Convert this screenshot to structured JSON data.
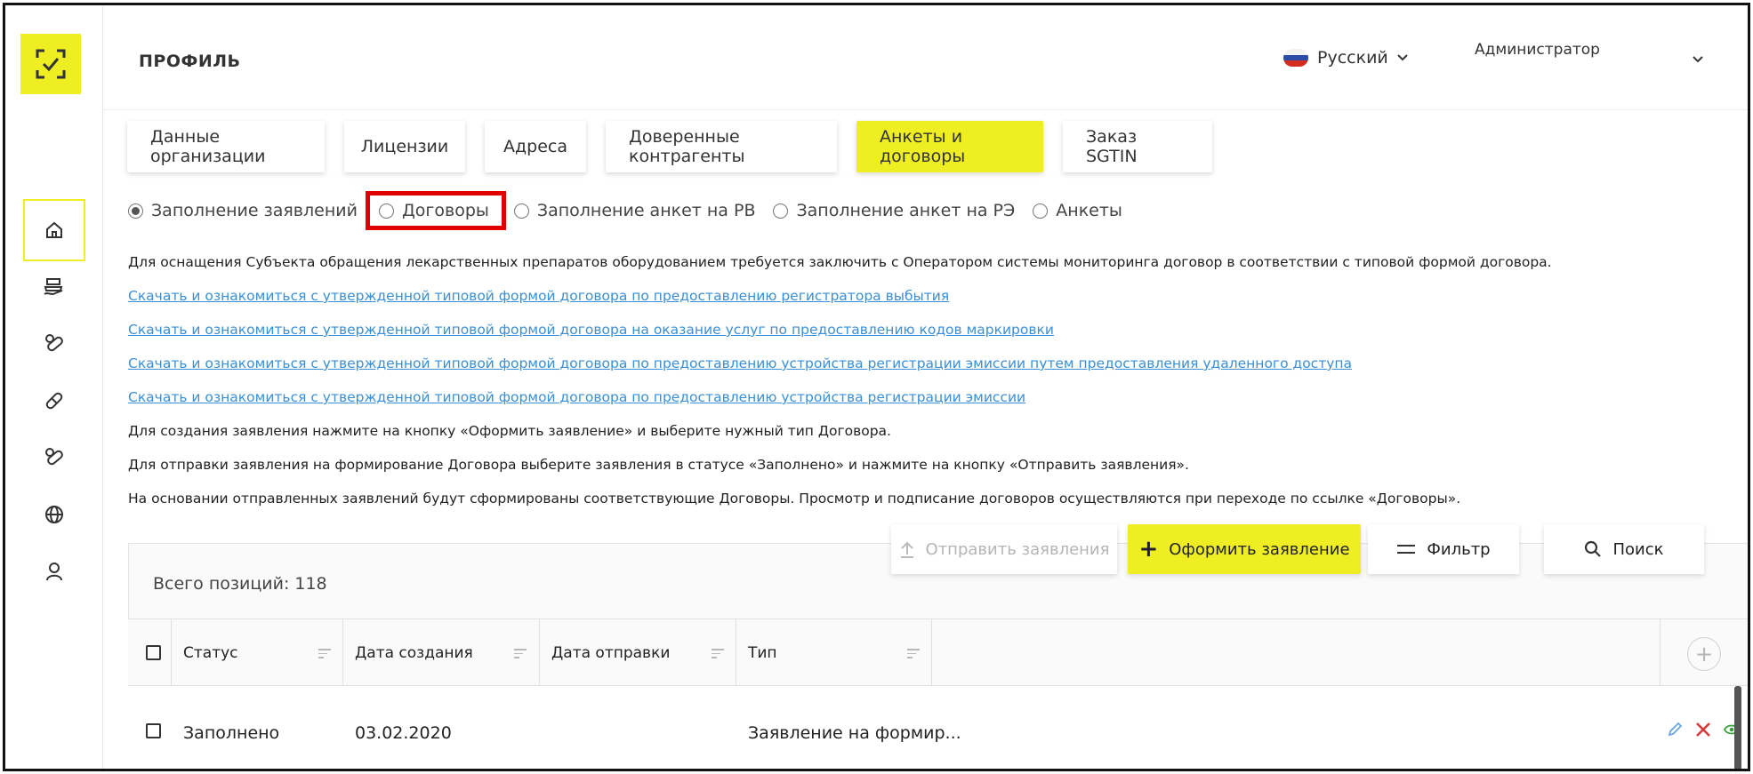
{
  "header": {
    "title": "ПРОФИЛЬ",
    "language": "Русский",
    "user": "Администратор"
  },
  "tabs": [
    {
      "label": "Данные организации",
      "active": false
    },
    {
      "label": "Лицензии",
      "active": false
    },
    {
      "label": "Адреса",
      "active": false
    },
    {
      "label": "Доверенные контрагенты",
      "active": false
    },
    {
      "label": "Анкеты и договоры",
      "active": true
    },
    {
      "label": "Заказ SGTIN",
      "active": false
    }
  ],
  "radios": [
    {
      "label": "Заполнение заявлений",
      "checked": true
    },
    {
      "label": "Договоры",
      "checked": false,
      "highlighted": true
    },
    {
      "label": "Заполнение анкет на РВ",
      "checked": false
    },
    {
      "label": "Заполнение анкет на РЭ",
      "checked": false
    },
    {
      "label": "Анкеты",
      "checked": false
    }
  ],
  "info": {
    "intro": "Для оснащения Субъекта обращения лекарственных препаратов оборудованием требуется заключить с Оператором системы мониторинга договор в соответствии с типовой формой договора.",
    "links": [
      "Скачать и ознакомиться с утвержденной типовой формой договора по предоставлению регистратора выбытия",
      "Скачать и ознакомиться с утвержденной типовой формой договора на оказание услуг по предоставлению кодов маркировки",
      "Скачать и ознакомиться с утвержденной типовой формой договора по предоставлению устройства регистрации эмиссии путем предоставления удаленного доступа",
      "Скачать и ознакомиться с утвержденной типовой формой договора по предоставлению устройства регистрации эмиссии"
    ],
    "step1": "Для создания заявления нажмите на кнопку «Оформить заявление» и выберите нужный тип Договора.",
    "step2": "Для отправки заявления на формирование Договора выберите заявления в статусе «Заполнено» и нажмите на кнопку «Отправить заявления».",
    "step3": "На основании отправленных заявлений будут сформированы соответствующие Договоры. Просмотр и подписание договоров осуществляются при переходе по ссылке «Договоры»."
  },
  "actions": {
    "send": "Отправить заявления",
    "create": "Оформить заявление",
    "filter": "Фильтр",
    "search": "Поиск"
  },
  "table": {
    "total": "Всего позиций: 118",
    "columns": [
      "Статус",
      "Дата создания",
      "Дата отправки",
      "Тип"
    ],
    "rows": [
      {
        "status": "Заполнено",
        "created": "03.02.2020",
        "sent": "",
        "type": "Заявление на формир..."
      }
    ]
  },
  "colors": {
    "accent": "#eeee22",
    "link": "#3a8fd6",
    "highlight": "#e00000",
    "delete": "#d83a3a",
    "view": "#3aa03a",
    "edit": "#6aa6e0"
  },
  "icons": {
    "sidebar": [
      "home-icon",
      "cash-register-icon",
      "pills-icon",
      "capsule-icon",
      "pills-icon",
      "globe-icon",
      "user-icon"
    ]
  }
}
